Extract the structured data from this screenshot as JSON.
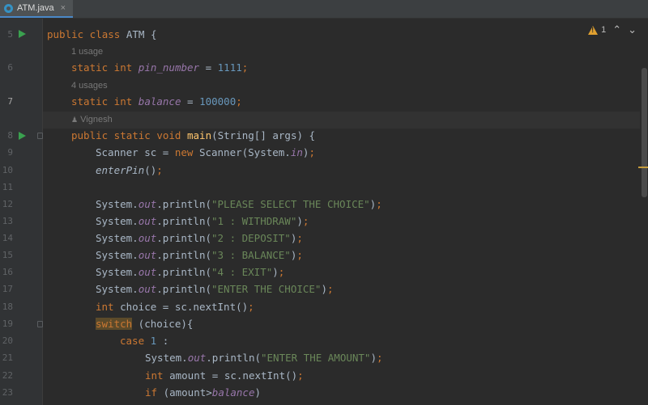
{
  "tab": {
    "filename": "ATM.java",
    "close": "×"
  },
  "toolbar": {
    "warning_count": "1",
    "up": "⌃",
    "down": "⌄"
  },
  "hints": {
    "h1": "1 usage",
    "h2": "4 usages",
    "h3": "Vignesh"
  },
  "lines": {
    "n5": "5",
    "n6": "6",
    "n7": "7",
    "n8": "8",
    "n9": "9",
    "n10": "10",
    "n11": "11",
    "n12": "12",
    "n13": "13",
    "n14": "14",
    "n15": "15",
    "n16": "16",
    "n17": "17",
    "n18": "18",
    "n19": "19",
    "n20": "20",
    "n21": "21",
    "n22": "22",
    "n23": "23"
  },
  "code": {
    "l5": {
      "a": "public class ",
      "b": "ATM {"
    },
    "l6": {
      "a": "static int ",
      "b": "pin_number",
      "c": " = ",
      "d": "1111",
      "e": ";"
    },
    "l7": {
      "a": "static int ",
      "b": "balance",
      "c": " = ",
      "d": "100000",
      "e": ";"
    },
    "l8": {
      "a": "public static void ",
      "b": "main",
      "c": "(String[] args) {"
    },
    "l9": {
      "a": "Scanner sc = ",
      "b": "new ",
      "c": "Scanner(System.",
      "d": "in",
      "e": ")",
      "f": ";"
    },
    "l10": {
      "a": "enterPin",
      "b": "()",
      "c": ";"
    },
    "l12": {
      "str": "\"PLEASE SELECT THE CHOICE\""
    },
    "l13": {
      "str": "\"1 : WITHDRAW\""
    },
    "l14": {
      "str": "\"2 : DEPOSIT\""
    },
    "l15": {
      "str": "\"3 : BALANCE\""
    },
    "l16": {
      "str": "\"4 : EXIT\""
    },
    "l17": {
      "str": "\"ENTER THE CHOICE\""
    },
    "l18": {
      "a": "int ",
      "b": "choice = sc.nextInt()",
      "c": ";"
    },
    "l19": {
      "a": "switch",
      "b": " (choice){"
    },
    "l20": {
      "a": "case ",
      "b": "1",
      "c": " :"
    },
    "l21": {
      "str": "\"ENTER THE AMOUNT\""
    },
    "l22": {
      "a": "int ",
      "b": "amount = sc.nextInt()",
      "c": ";"
    },
    "l23": {
      "a": "if ",
      "b": "(amount>",
      "c": "balance",
      "d": ")"
    },
    "sys": "System.",
    "out": "out",
    "println": ".println(",
    "close": ")",
    "semi": ";"
  }
}
